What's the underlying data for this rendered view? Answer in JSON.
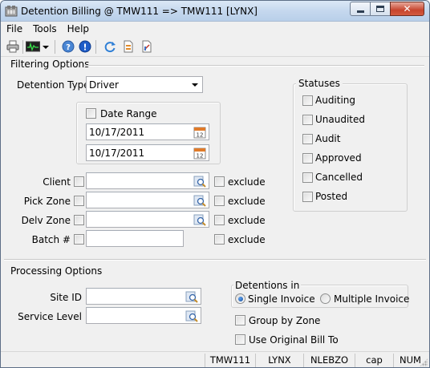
{
  "window": {
    "title": "Detention Billing @ TMW111 => TMW111 [LYNX]"
  },
  "menu": {
    "items": [
      "File",
      "Tools",
      "Help"
    ]
  },
  "toolbar": {
    "icons": [
      "print-icon",
      "monitor-icon",
      "dropdown-arrow-icon",
      "help-icon",
      "info-icon",
      "refresh-icon",
      "document-icon",
      "report-icon"
    ]
  },
  "filtering": {
    "section_label": "Filtering Options",
    "detention_type": {
      "label": "Detention Type",
      "value": "Driver"
    },
    "date_range": {
      "label": "Date Range",
      "checked": false,
      "start": "10/17/2011",
      "end": "10/17/2011"
    },
    "client": {
      "label": "Client",
      "value": "",
      "exclude_label": "exclude"
    },
    "pick_zone": {
      "label": "Pick Zone",
      "value": "",
      "exclude_label": "exclude"
    },
    "delv_zone": {
      "label": "Delv Zone",
      "value": "",
      "exclude_label": "exclude"
    },
    "batch": {
      "label": "Batch #",
      "value": "",
      "exclude_label": "exclude"
    }
  },
  "statuses": {
    "label": "Statuses",
    "items": [
      "Auditing",
      "Unaudited",
      "Audit",
      "Approved",
      "Cancelled",
      "Posted"
    ]
  },
  "processing": {
    "section_label": "Processing Options",
    "site_id": {
      "label": "Site ID",
      "value": ""
    },
    "service_level": {
      "label": "Service Level",
      "value": ""
    },
    "detentions_in": {
      "label": "Detentions in",
      "options": [
        "Single Invoice",
        "Multiple Invoice"
      ],
      "selected": "Single Invoice"
    },
    "group_by_zone": "Group by Zone",
    "use_original_bill_to": "Use Original Bill To"
  },
  "statusbar": {
    "panes": [
      "TMW111",
      "LYNX",
      "NLEBZO",
      "cap",
      "NUM"
    ]
  },
  "colors": {
    "titlebar": "#c5d8ee",
    "close_button": "#c7452e",
    "window_bg": "#f0f0f0"
  }
}
